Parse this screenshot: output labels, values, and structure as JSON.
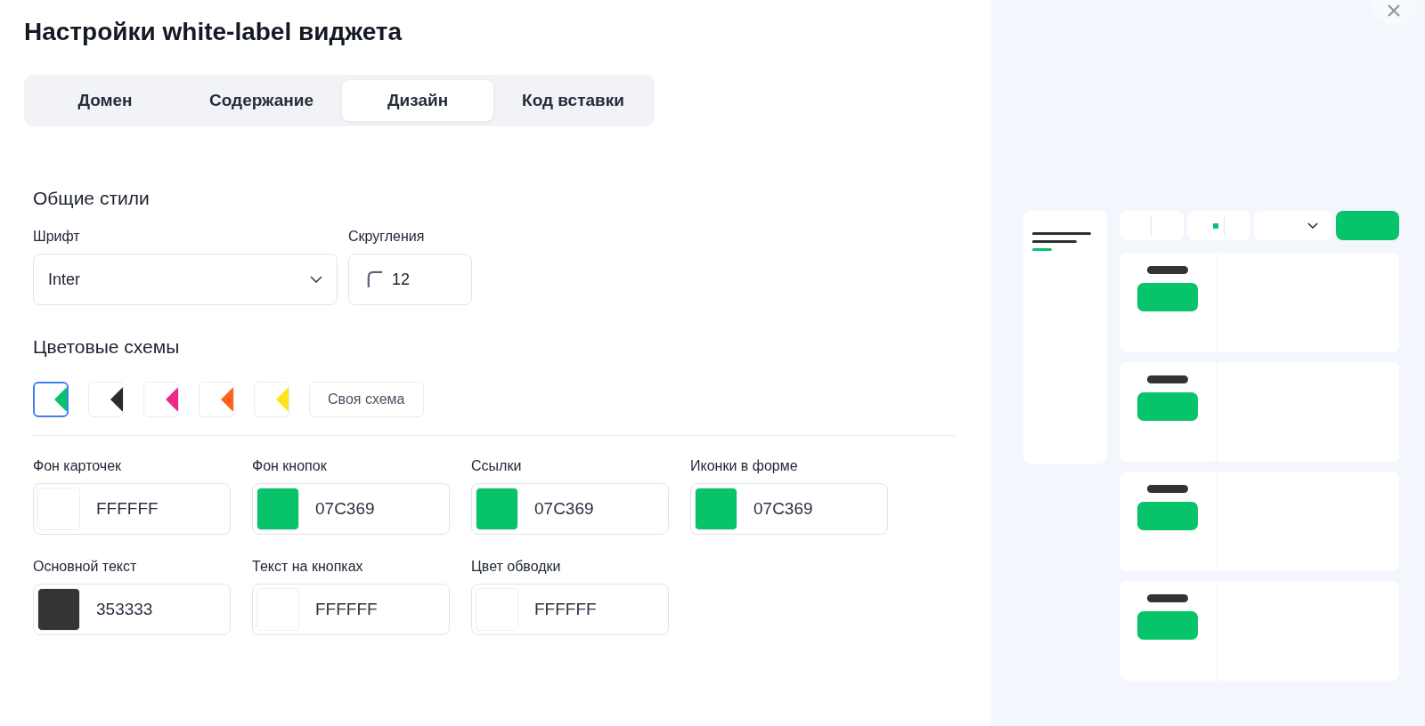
{
  "title": "Настройки white-label виджета",
  "tabs": [
    {
      "label": "Домен",
      "selected": false
    },
    {
      "label": "Содержание",
      "selected": false
    },
    {
      "label": "Дизайн",
      "selected": true
    },
    {
      "label": "Код вставки",
      "selected": false
    }
  ],
  "general_styles": {
    "heading": "Общие стили",
    "font": {
      "label": "Шрифт",
      "value": "Inter"
    },
    "rounding": {
      "label": "Скругления",
      "value": "12"
    }
  },
  "color_schemes": {
    "heading": "Цветовые схемы",
    "presets": [
      {
        "color": "#07c369",
        "selected": true
      },
      {
        "color": "#2b2b2b",
        "selected": false
      },
      {
        "color": "#f0288c",
        "selected": false
      },
      {
        "color": "#ff6320",
        "selected": false
      },
      {
        "color": "#ffe11e",
        "selected": false
      }
    ],
    "custom": {
      "label": "Своя схема",
      "selected": false
    }
  },
  "colors": [
    {
      "label": "Фон карточек",
      "value": "FFFFFF",
      "color": "#ffffff"
    },
    {
      "label": "Фон кнопок",
      "value": "07C369",
      "color": "#07c369"
    },
    {
      "label": "Ссылки",
      "value": "07C369",
      "color": "#07c369"
    },
    {
      "label": "Иконки в форме",
      "value": "07C369",
      "color": "#07c369"
    },
    {
      "label": "Основной текст",
      "value": "353333",
      "color": "#353333"
    },
    {
      "label": "Текст на кнопках",
      "value": "FFFFFF",
      "color": "#ffffff"
    },
    {
      "label": "Цвет обводки",
      "value": "FFFFFF",
      "color": "#ffffff"
    }
  ]
}
